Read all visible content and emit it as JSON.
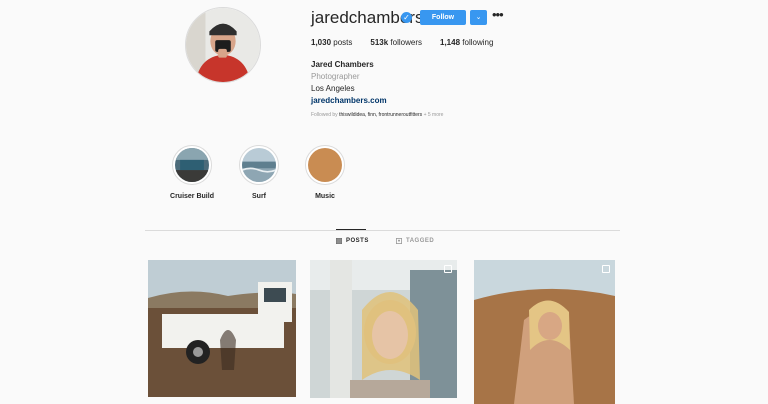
{
  "profile": {
    "username": "jaredchambers",
    "follow_label": "Follow",
    "dropdown_glyph": "⌄",
    "more_glyph": "•••",
    "verified_glyph": "✓",
    "stats": {
      "posts": "1,030",
      "posts_label": "posts",
      "followers": "513k",
      "followers_label": "followers",
      "following": "1,148",
      "following_label": "following"
    },
    "full_name": "Jared Chambers",
    "bio": "Photographer",
    "location": "Los Angeles",
    "website": "jaredchambers.com",
    "followed_by_prefix": "Followed by ",
    "followed_by_names": "thiswildidea, finn, frontrunneroutfitters",
    "followed_by_suffix": " + 5 more"
  },
  "highlights": [
    {
      "label": "Cruiser Build"
    },
    {
      "label": "Surf"
    },
    {
      "label": "Music"
    }
  ],
  "tabs": {
    "posts": "POSTS",
    "tagged": "TAGGED"
  },
  "colors": {
    "accent": "#3897f0",
    "link": "#003569",
    "background": "#fafafa"
  }
}
